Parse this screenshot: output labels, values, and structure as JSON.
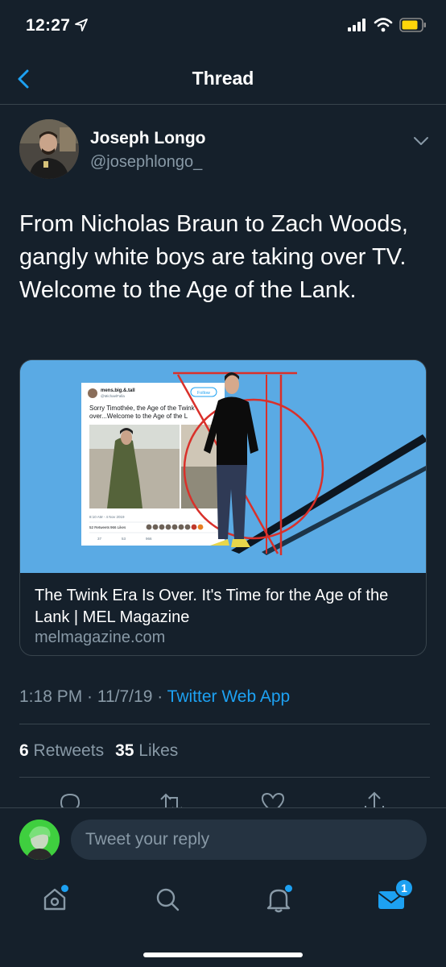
{
  "status_bar": {
    "time": "12:27"
  },
  "nav": {
    "title": "Thread"
  },
  "tweet": {
    "author_name": "Joseph Longo",
    "author_handle": "@josephlongo_",
    "text": "From Nicholas Braun to Zach Woods, gangly white boys are taking over TV. Welcome to the Age of the Lank.",
    "card": {
      "title": "The Twink Era Is Over. It's Time for the Age of the Lank | MEL Magazine",
      "domain": "melmagazine.com",
      "embedded_tweet": {
        "user": "mens.big.&.tall",
        "handle": "@MichaelFalla",
        "follow_label": "Follow",
        "text_line1": "Sorry Timothée, the Age of the Twink",
        "text_line2": "over...Welcome to the Age of the L",
        "timestamp": "8:10 AM - 4 Nov 2019",
        "retweets": "52 Retweets",
        "likes": "966 Likes",
        "reply_count": "37",
        "rt_count": "53",
        "like_count": "966"
      }
    },
    "timestamp": "1:18 PM · 11/7/19 ·",
    "source": "Twitter Web App",
    "retweet_count": "6",
    "retweet_label": "Retweets",
    "like_count": "35",
    "like_label": "Likes"
  },
  "reply": {
    "placeholder": "Tweet your reply"
  },
  "tab_bar": {
    "messages_badge": "1"
  },
  "colors": {
    "background": "#15202b",
    "accent": "#1da1f2",
    "muted": "#8899a6",
    "divider": "#38444d"
  }
}
